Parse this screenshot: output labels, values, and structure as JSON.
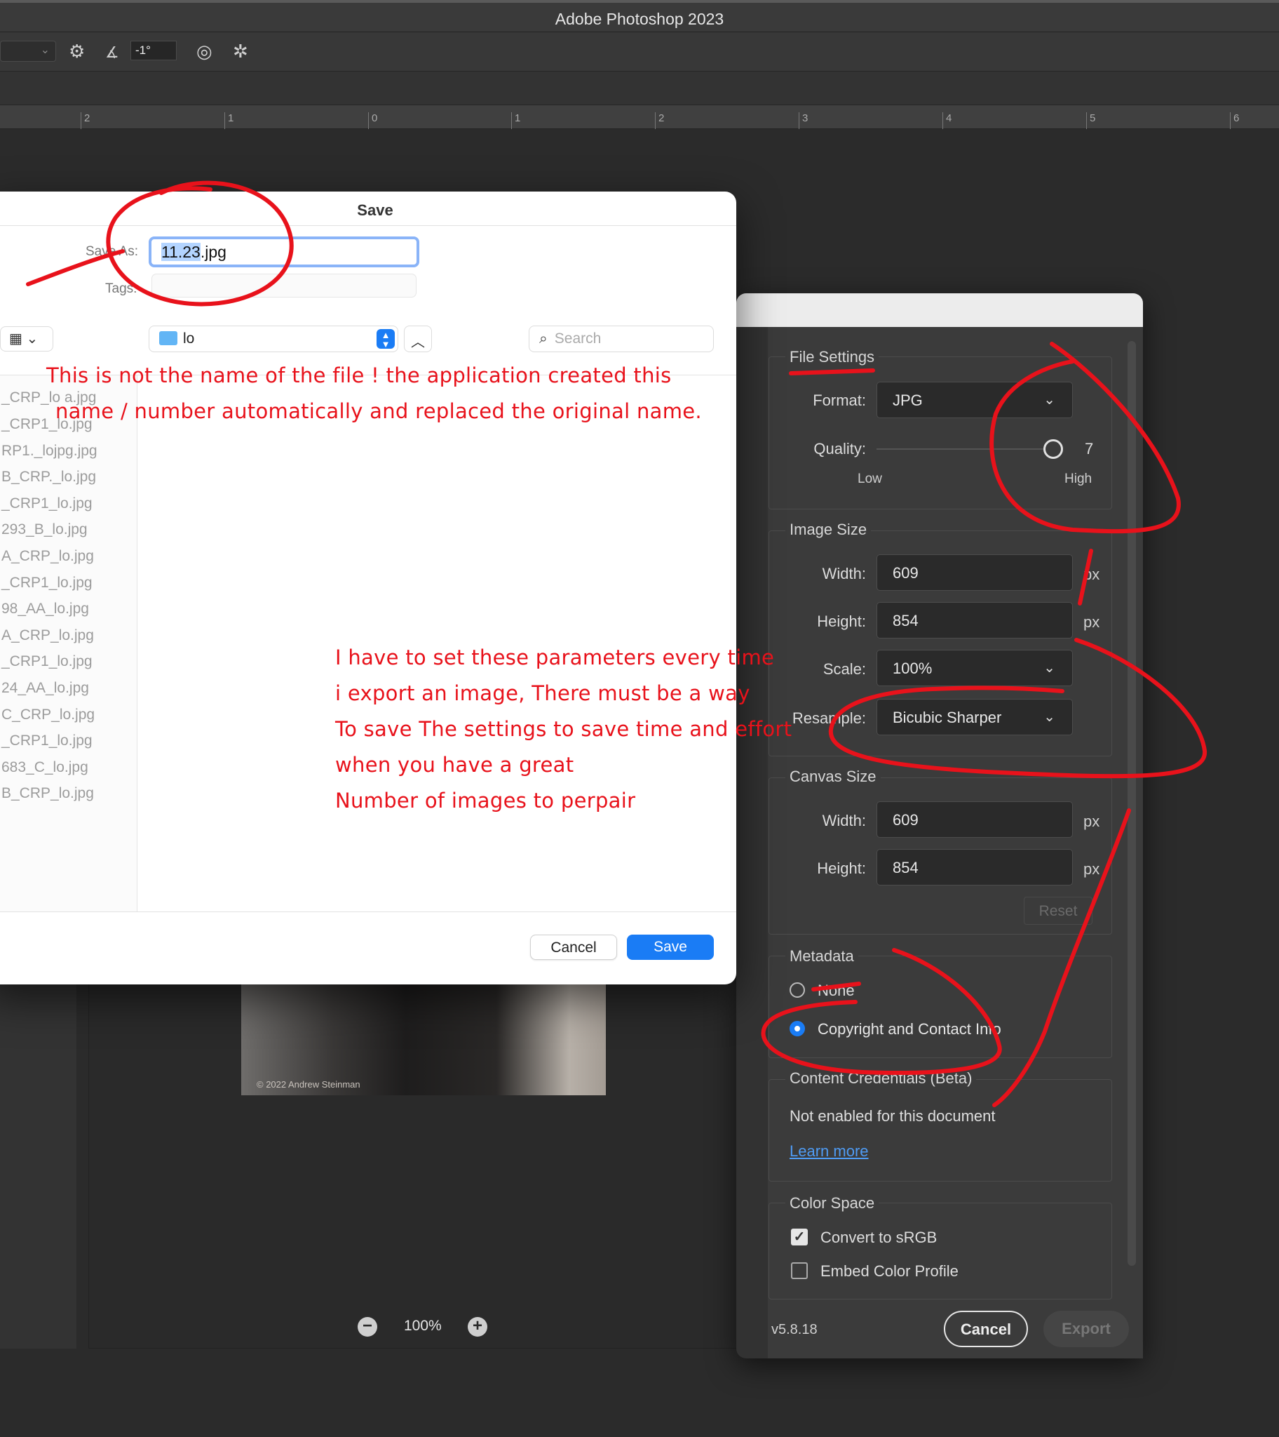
{
  "app": {
    "title": "Adobe Photoshop 2023"
  },
  "options_bar": {
    "angle_value": "-1°"
  },
  "ruler": {
    "ticks": [
      "2",
      "1",
      "0",
      "1",
      "2",
      "3",
      "4",
      "5",
      "6"
    ]
  },
  "save_dialog": {
    "title": "Save",
    "save_as_label": "Save As:",
    "filename_selected": "11.23",
    "filename_ext": ".jpg",
    "tags_label": "Tags:",
    "location": "lo",
    "search_placeholder": "Search",
    "files": [
      "_CRP_lo a.jpg",
      "_CRP1_lo.jpg",
      "RP1._lojpg.jpg",
      "B_CRP._lo.jpg",
      "_CRP1_lo.jpg",
      "293_B_lo.jpg",
      "A_CRP_lo.jpg",
      "_CRP1_lo.jpg",
      "98_AA_lo.jpg",
      "A_CRP_lo.jpg",
      "_CRP1_lo.jpg",
      "24_AA_lo.jpg",
      "C_CRP_lo.jpg",
      "_CRP1_lo.jpg",
      "683_C_lo.jpg",
      "B_CRP_lo.jpg"
    ],
    "cancel_label": "Cancel",
    "save_label": "Save"
  },
  "export": {
    "file_settings": {
      "title": "File Settings",
      "format_label": "Format:",
      "format_value": "JPG",
      "quality_label": "Quality:",
      "quality_value": "7",
      "quality_fraction": 0.97,
      "low_label": "Low",
      "high_label": "High"
    },
    "image_size": {
      "title": "Image Size",
      "width_label": "Width:",
      "width_value": "609",
      "height_label": "Height:",
      "height_value": "854",
      "scale_label": "Scale:",
      "scale_value": "100%",
      "resample_label": "Resample:",
      "resample_value": "Bicubic Sharper",
      "unit": "px"
    },
    "canvas_size": {
      "title": "Canvas Size",
      "width_label": "Width:",
      "width_value": "609",
      "height_label": "Height:",
      "height_value": "854",
      "unit": "px",
      "reset_label": "Reset"
    },
    "metadata": {
      "title": "Metadata",
      "none_label": "None",
      "copyright_label": "Copyright and Contact Info",
      "selected": "copyright"
    },
    "content_credentials": {
      "title": "Content Credentials (Beta)",
      "status": "Not enabled for this document",
      "learn_more": "Learn more"
    },
    "color_space": {
      "title": "Color Space",
      "convert_label": "Convert to sRGB",
      "convert_checked": true,
      "embed_label": "Embed Color Profile",
      "embed_checked": false
    },
    "version": "v5.8.18",
    "cancel_label": "Cancel",
    "export_label": "Export"
  },
  "canvas": {
    "zoom": "100%",
    "photo_credit": "© 2022 Andrew Steinman"
  },
  "annotations": {
    "note1_line1": "This is not the name of the file ! the application created this",
    "note1_line2": "name / number automatically and replaced the original name.",
    "note2_line1": "I have to set these parameters every time",
    "note2_line2": "i export an image, There must be a way",
    "note2_line3": "To save The settings to save time and effort",
    "note2_line4": "when you have a great",
    "note2_line5": "Number of images to perpair",
    "ink_color": "#e8121b"
  },
  "colors": {
    "accent_blue": "#1a7cf5",
    "panel_bg": "#3b3b3b",
    "app_bg": "#2b2b2b"
  }
}
